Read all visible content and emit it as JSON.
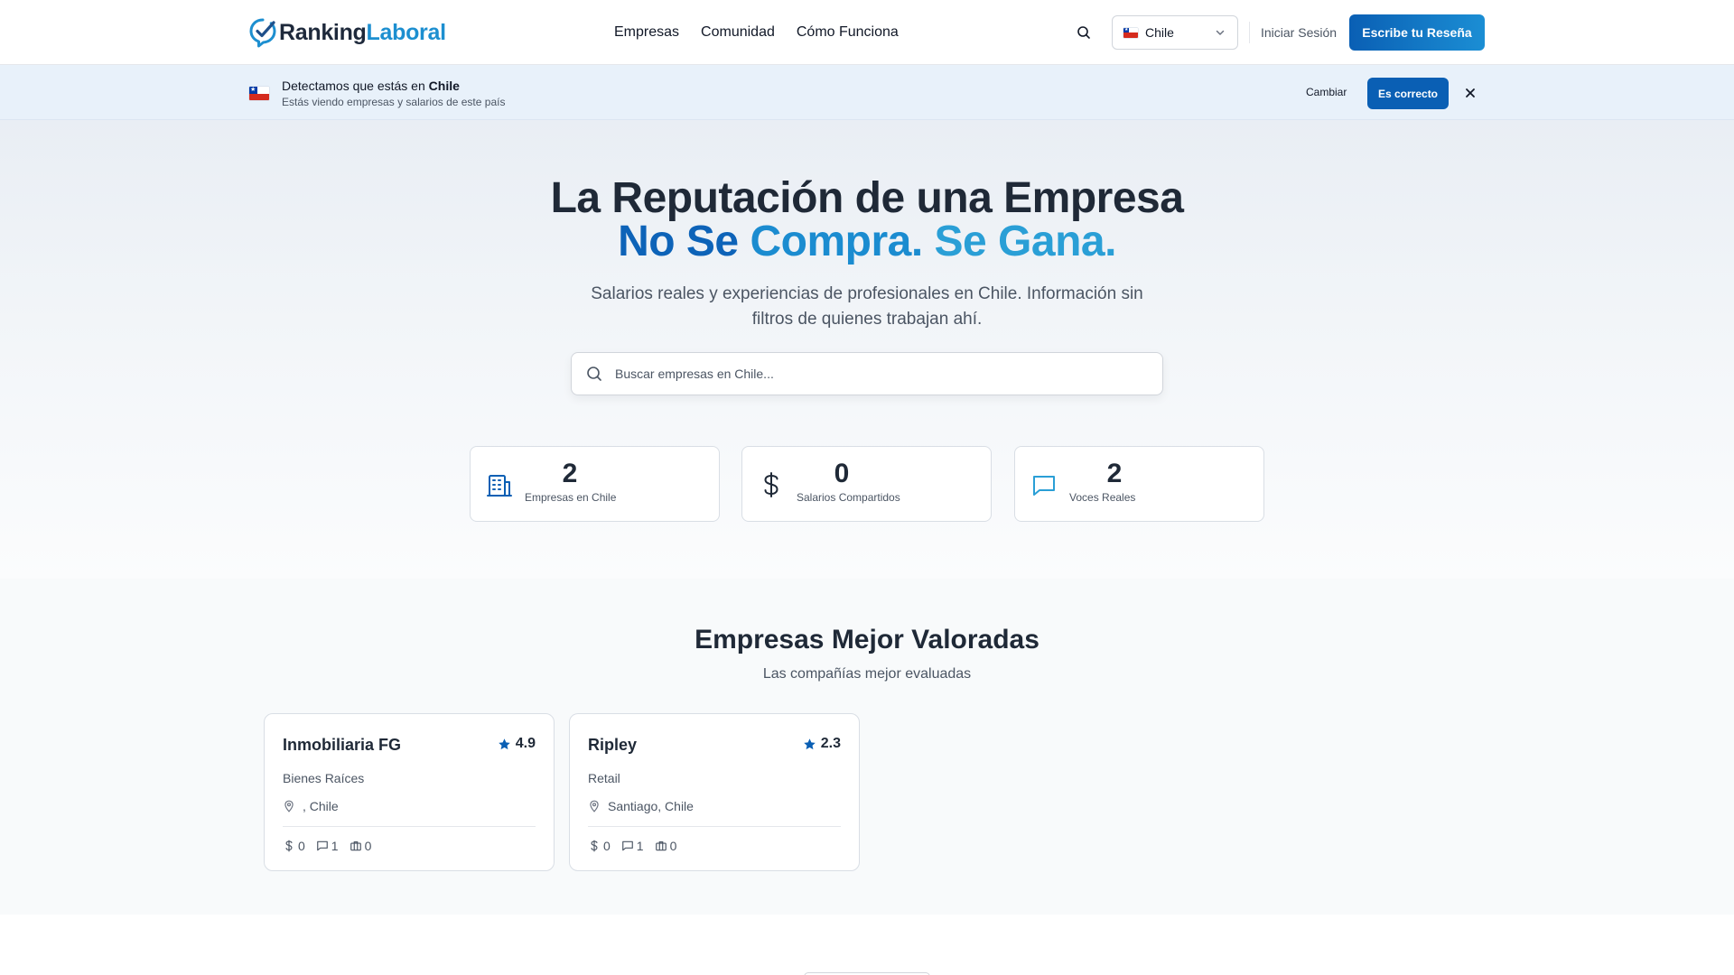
{
  "header": {
    "logo": {
      "part1": "Ranking",
      "part2": "Laboral"
    },
    "nav": [
      "Empresas",
      "Comunidad",
      "Cómo Funciona"
    ],
    "country": "Chile",
    "login": "Iniciar Sesión",
    "cta": "Escribe tu Reseña"
  },
  "banner": {
    "title_prefix": "Detectamos que estás en ",
    "title_country": "Chile",
    "subtitle": "Estás viendo empresas y salarios de este país",
    "change": "Cambiar",
    "confirm": "Es correcto"
  },
  "hero": {
    "title": "La Reputación de una Empresa",
    "title2_a": "No Se ",
    "title2_b": "Compra. ",
    "title2_c": "Se Gana.",
    "lead": "Salarios reales y experiencias de profesionales en Chile. Información sin filtros de quienes trabajan ahí.",
    "search_placeholder": "Buscar empresas en Chile..."
  },
  "stats": [
    {
      "value": "2",
      "label": "Empresas en Chile",
      "icon": "building-icon"
    },
    {
      "value": "0",
      "label": "Salarios Compartidos",
      "icon": "dollar-icon"
    },
    {
      "value": "2",
      "label": "Voces Reales",
      "icon": "chat-icon"
    }
  ],
  "top_rated": {
    "title": "Empresas Mejor Valoradas",
    "subtitle": "Las compañías mejor evaluadas",
    "companies": [
      {
        "name": "Inmobiliaria FG",
        "rating": "4.9",
        "industry": "Bienes Raíces",
        "location": ", Chile",
        "salaries": "0",
        "reviews": "1",
        "jobs": "0"
      },
      {
        "name": "Ripley",
        "rating": "2.3",
        "industry": "Retail",
        "location": "Santiago, Chile",
        "salaries": "0",
        "reviews": "1",
        "jobs": "0"
      }
    ]
  },
  "colors": {
    "brand_dark": "#0a5fb4",
    "brand_light": "#1b8ed4",
    "text": "#1f2937",
    "muted": "#4b5563"
  }
}
